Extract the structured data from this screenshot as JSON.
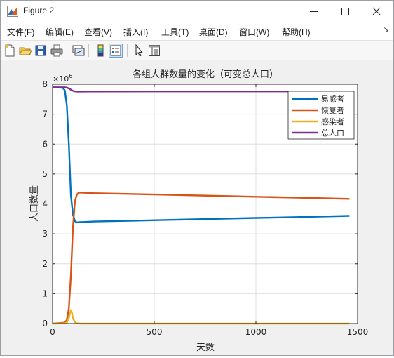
{
  "window": {
    "title": "Figure 2"
  },
  "menu": [
    {
      "label": "文件(F)"
    },
    {
      "label": "编辑(E)"
    },
    {
      "label": "查看(V)"
    },
    {
      "label": "插入(I)"
    },
    {
      "label": "工具(T)"
    },
    {
      "label": "桌面(D)"
    },
    {
      "label": "窗口(W)"
    },
    {
      "label": "帮助(H)"
    }
  ],
  "toolbar": [
    {
      "icon": "new-figure-icon"
    },
    {
      "icon": "open-file-icon"
    },
    {
      "icon": "save-icon"
    },
    {
      "icon": "print-icon"
    },
    {
      "icon": "link-plot-icon"
    },
    {
      "icon": "insert-colorbar-icon"
    },
    {
      "icon": "insert-legend-icon"
    },
    {
      "icon": "edit-plot-pointer-icon"
    },
    {
      "icon": "property-inspector-icon"
    }
  ],
  "chart_data": {
    "type": "line",
    "title": "各组人群数量的变化（可变总人口）",
    "xlabel": "天数",
    "ylabel": "人口数量",
    "y_exponent_label": "×10",
    "y_exponent_power": "6",
    "xlim": [
      0,
      1500
    ],
    "ylim": [
      0,
      8000000
    ],
    "xticks": [
      0,
      500,
      1000,
      1500
    ],
    "yticks": [
      0,
      1000000,
      2000000,
      3000000,
      4000000,
      5000000,
      6000000,
      7000000,
      8000000
    ],
    "xtick_labels": [
      "0",
      "500",
      "1000",
      "1500"
    ],
    "ytick_labels": [
      "0",
      "1",
      "2",
      "3",
      "4",
      "5",
      "6",
      "7",
      "8"
    ],
    "grid": true,
    "legend_position": "top-right",
    "series": [
      {
        "name": "易感者",
        "color": "#0072bd",
        "x": [
          0,
          50,
          60,
          70,
          80,
          90,
          100,
          110,
          120,
          130,
          150,
          200,
          400,
          600,
          800,
          1000,
          1200,
          1460
        ],
        "y": [
          7900000,
          7880000,
          7800000,
          7300000,
          6000000,
          4300000,
          3650000,
          3420000,
          3380000,
          3390000,
          3395000,
          3410000,
          3440000,
          3470000,
          3500000,
          3530000,
          3560000,
          3600000
        ]
      },
      {
        "name": "恢复者",
        "color": "#d95319",
        "x": [
          0,
          60,
          70,
          80,
          90,
          100,
          110,
          120,
          130,
          150,
          200,
          400,
          600,
          800,
          1000,
          1200,
          1460
        ],
        "y": [
          0,
          30000,
          120000,
          500000,
          1600000,
          3200000,
          4100000,
          4320000,
          4380000,
          4375000,
          4360000,
          4330000,
          4300000,
          4270000,
          4240000,
          4210000,
          4170000
        ]
      },
      {
        "name": "感染者",
        "color": "#edb120",
        "x": [
          0,
          60,
          70,
          80,
          85,
          90,
          95,
          100,
          110,
          120,
          140,
          200,
          1460
        ],
        "y": [
          0,
          8000,
          40000,
          180000,
          330000,
          450000,
          380000,
          180000,
          50000,
          10000,
          0,
          0,
          0
        ]
      },
      {
        "name": "总人口",
        "color": "#7e2f8e",
        "x": [
          0,
          60,
          70,
          80,
          90,
          100,
          110,
          120,
          140,
          200,
          500,
          1000,
          1460
        ],
        "y": [
          7900000,
          7900000,
          7890000,
          7860000,
          7820000,
          7780000,
          7760000,
          7755000,
          7757000,
          7758000,
          7760000,
          7760000,
          7760000
        ]
      }
    ]
  }
}
